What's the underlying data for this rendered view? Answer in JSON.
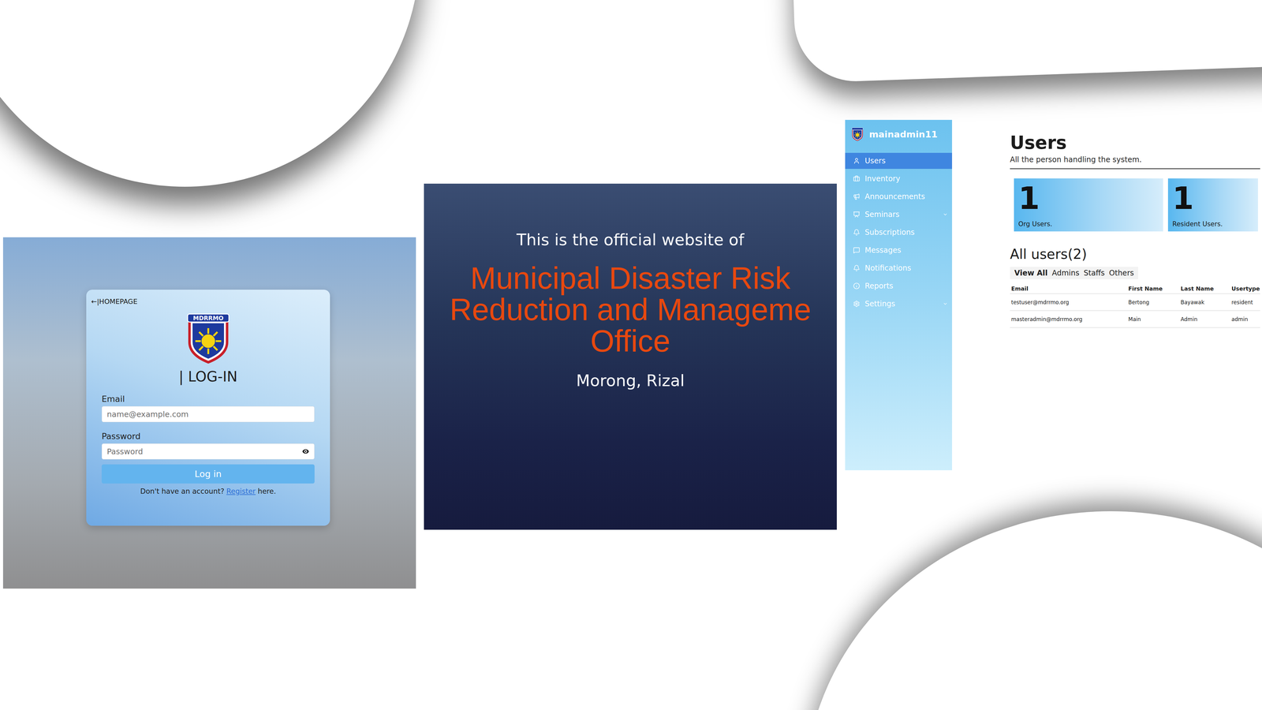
{
  "login": {
    "back_link": "←|HOMEPAGE",
    "logo_text": "MDRRMO",
    "title": "| LOG-IN",
    "fields": [
      {
        "label": "Email",
        "placeholder": "name@example.com",
        "kind": "text"
      },
      {
        "label": "Password",
        "placeholder": "Password",
        "kind": "password"
      }
    ],
    "button": "Log in",
    "footer": {
      "text": "Don't have an account?",
      "link": "Register",
      "suffix": "here."
    }
  },
  "hero": {
    "intro": "This is the official website of",
    "title_lines": [
      "Municipal Disaster Risk",
      "Reduction and Manageme",
      "Office"
    ],
    "place": "Morong, Rizal"
  },
  "sidebar": {
    "user": "mainadmin11",
    "items": [
      {
        "label": "Users",
        "selected": true,
        "expandable": false
      },
      {
        "label": "Inventory",
        "selected": false,
        "expandable": false
      },
      {
        "label": "Announcements",
        "selected": false,
        "expandable": false
      },
      {
        "label": "Seminars",
        "selected": false,
        "expandable": true
      },
      {
        "label": "Subscriptions",
        "selected": false,
        "expandable": false
      },
      {
        "label": "Messages",
        "selected": false,
        "expandable": false
      },
      {
        "label": "Notifications",
        "selected": false,
        "expandable": false
      },
      {
        "label": "Reports",
        "selected": false,
        "expandable": false
      },
      {
        "label": "Settings",
        "selected": false,
        "expandable": true
      }
    ]
  },
  "users_page": {
    "title": "Users",
    "subtitle": "All the person handling the system.",
    "stats": [
      {
        "count": "1",
        "label": "Org Users."
      },
      {
        "count": "1",
        "label": "Resident Users."
      }
    ],
    "list_title": "All users(2)",
    "tabs": [
      {
        "label": "View All",
        "selected": true
      },
      {
        "label": "Admins",
        "selected": false
      },
      {
        "label": "Staffs",
        "selected": false
      },
      {
        "label": "Others",
        "selected": false
      }
    ],
    "table": {
      "columns": [
        "Email",
        "First Name",
        "Last Name",
        "Usertype"
      ],
      "rows": [
        [
          "testuser@mdrrmo.org",
          "Bertong",
          "Bayawak",
          "resident"
        ],
        [
          "masteradmin@mdrrmo.org",
          "Main",
          "Admin",
          "admin"
        ]
      ]
    }
  }
}
